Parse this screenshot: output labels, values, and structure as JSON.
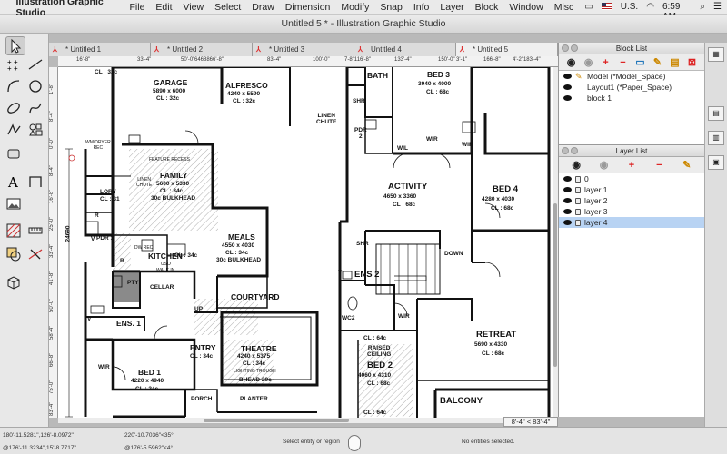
{
  "menubar": {
    "app_name": "Illustration Graphic Studio",
    "items": [
      "File",
      "Edit",
      "View",
      "Select",
      "Draw",
      "Dimension",
      "Modify",
      "Snap",
      "Info",
      "Layer",
      "Block",
      "Window",
      "Misc"
    ],
    "status": {
      "battery": "U.S.",
      "clock": "Sat 6:59 AM"
    }
  },
  "window": {
    "title": "Untitled 5 * - Illustration Graphic Studio"
  },
  "tabs": [
    "* Untitled 1",
    "* Untitled 2",
    "* Untitled 3",
    "Untitled 4",
    "* Untitled 5"
  ],
  "ruler": {
    "h": [
      "16'-8\"",
      "33'-4\"",
      "50'-0\"",
      "6468866'-8\"",
      "83'-4\"",
      "100'-0\"",
      "7-8\"116'-8\"",
      "133'-4\"",
      "150'-0\"",
      "3'-1\"",
      "166'-8\"",
      "4'-2\"183'-4\""
    ],
    "v": [
      "1'-8\"",
      "8'-4\"",
      "0'-0\"",
      "8'-4\"",
      "16'-8\"",
      "25'-0\"",
      "33'-4\"",
      "41'-8\"",
      "50'-0\"",
      "58'-4\"",
      "66'-8\"",
      "75'-0\"",
      "83'-4\""
    ]
  },
  "plan": {
    "dim_left": "24690",
    "rooms": {
      "clpart": "CL : 32c",
      "garage": {
        "name": "GARAGE",
        "size": "5890 x 6000",
        "cl": "CL : 32c"
      },
      "alfresco": {
        "name": "ALFRESCO",
        "size": "4240 x 5590",
        "cl": "CL : 32c"
      },
      "bath": "BATH",
      "bed3": {
        "name": "BED 3",
        "size": "3940 x 4000",
        "cl": "CL : 68c"
      },
      "linen": "LINEN\nCHUTE",
      "shr": "SHR",
      "pdr": "PDR\n2",
      "wil": "WIL",
      "wir1": "WIR",
      "wir2": "WIR",
      "wmdryer": "WM/DRYER\nREC",
      "feature": "FEATURE RECESS",
      "family": {
        "name": "FAMILY",
        "size": "5600 x 5330",
        "cl": "CL : 34c",
        "note": "30c BULKHEAD"
      },
      "linen2": "LINEN\nCHUTE",
      "lory": "LORY",
      "cl3": "CL : 31",
      "pdr1": "PDR 1",
      "activity": {
        "name": "ACTIVITY",
        "size": "4650 x 3360",
        "cl": "CL : 68c"
      },
      "bed4": {
        "name": "BED 4",
        "size": "4280 x 4030",
        "cl": "CL : 68c"
      },
      "meals": {
        "name": "MEALS",
        "size": "4550 x 4030",
        "cl": "CL : 34c",
        "note": "30c BULKHEAD"
      },
      "kitchen": {
        "name": "KITCHEN",
        "cl": "CL : 34c"
      },
      "dwrec": "DW REC",
      "uso": "USO",
      "walkin": "WALK IN",
      "pty": "PTY",
      "cellar": "CELLAR",
      "courtyard": "COURTYARD",
      "shr2": "SHR",
      "ens2": "ENS 2",
      "down": "DOWN",
      "wc2": "WC2",
      "wir3": "WIR",
      "up": "UP",
      "ens1": "ENS. 1",
      "wir4": "WIR",
      "bed1": {
        "name": "BED 1",
        "size": "4220 x 4940",
        "cl": "CL : 34c"
      },
      "entry": {
        "name": "ENTRY",
        "cl": "CL : 34c"
      },
      "theatre": {
        "name": "THEATRE",
        "size": "4240 x 5375",
        "cl": "CL : 34c",
        "note1": "LIGHTING TROUGH",
        "note2": "BHEAD 29c"
      },
      "porch": "PORCH",
      "planter": "PLANTER",
      "cl64a": "CL : 64c",
      "raised": "RAISED\nCEILING",
      "bed2": {
        "name": "BED 2",
        "size": "4060 x 4310",
        "cl": "CL : 68c"
      },
      "cl64b": "CL : 64c",
      "retreat": {
        "name": "RETREAT",
        "size": "5690 x 4330",
        "cl": "CL : 68c"
      },
      "balcony": "BALCONY",
      "r1": "R",
      "r2": "R",
      "v1": "V",
      "v2": "V",
      "v3": "V"
    }
  },
  "coord_readout": "8'-4\" < 83'-4\"",
  "status_bar": {
    "c1a": "180'-11.5281\",126'-8.0972\"",
    "c1b": "@176'-11.3234\",15'-8.7717\"",
    "c2a": "220'-10.7036\"<35°",
    "c2b": "@176'-5.5962\"<4°",
    "prompt": "Select entity or region",
    "selection": "No entities selected."
  },
  "block_list": {
    "title": "Block List",
    "items": [
      "Model (*Model_Space)",
      "Layout1 (*Paper_Space)",
      "block 1"
    ]
  },
  "layer_list": {
    "title": "Layer List",
    "items": [
      "0",
      "layer 1",
      "layer 2",
      "layer 3",
      "layer 4"
    ],
    "selected": "layer 4"
  }
}
